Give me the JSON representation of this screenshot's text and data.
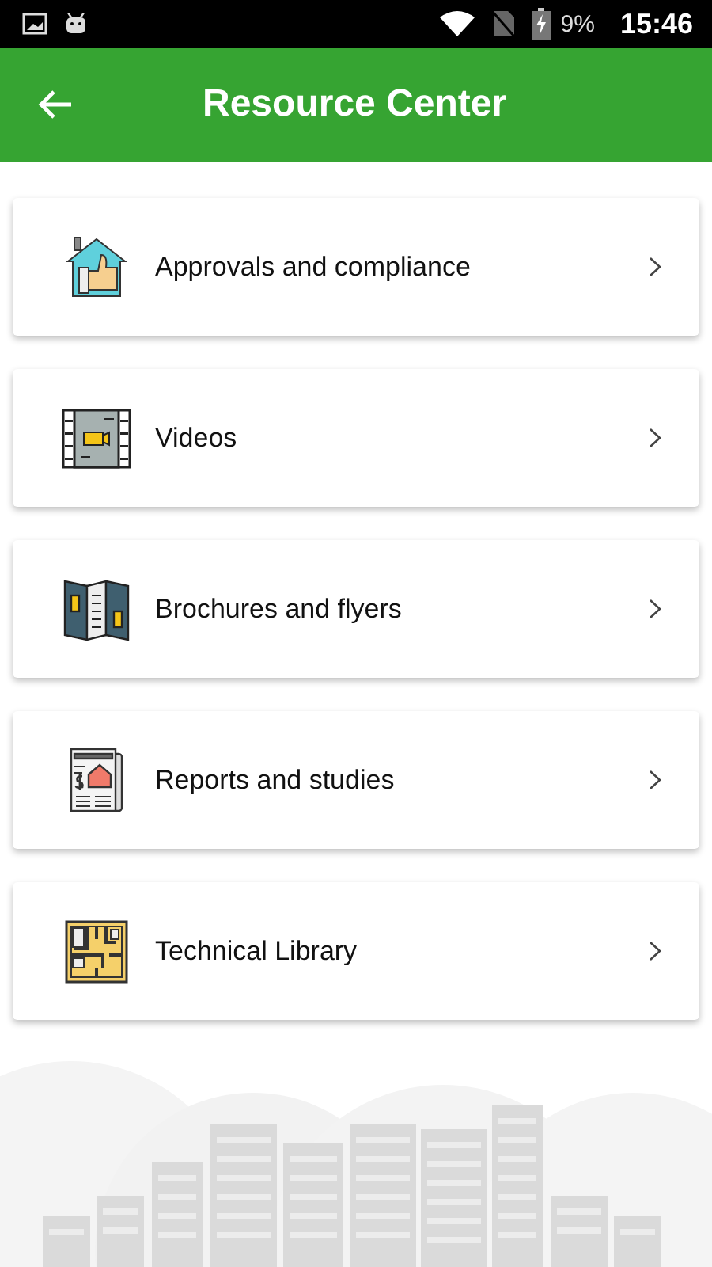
{
  "status_bar": {
    "battery": "9%",
    "time": "15:46"
  },
  "app_bar": {
    "title": "Resource Center"
  },
  "items": [
    {
      "label": "Approvals and compliance",
      "kind": "approvals"
    },
    {
      "label": "Videos",
      "kind": "videos"
    },
    {
      "label": "Brochures and flyers",
      "kind": "brochures"
    },
    {
      "label": "Reports and studies",
      "kind": "reports"
    },
    {
      "label": "Technical Library",
      "kind": "library"
    }
  ]
}
